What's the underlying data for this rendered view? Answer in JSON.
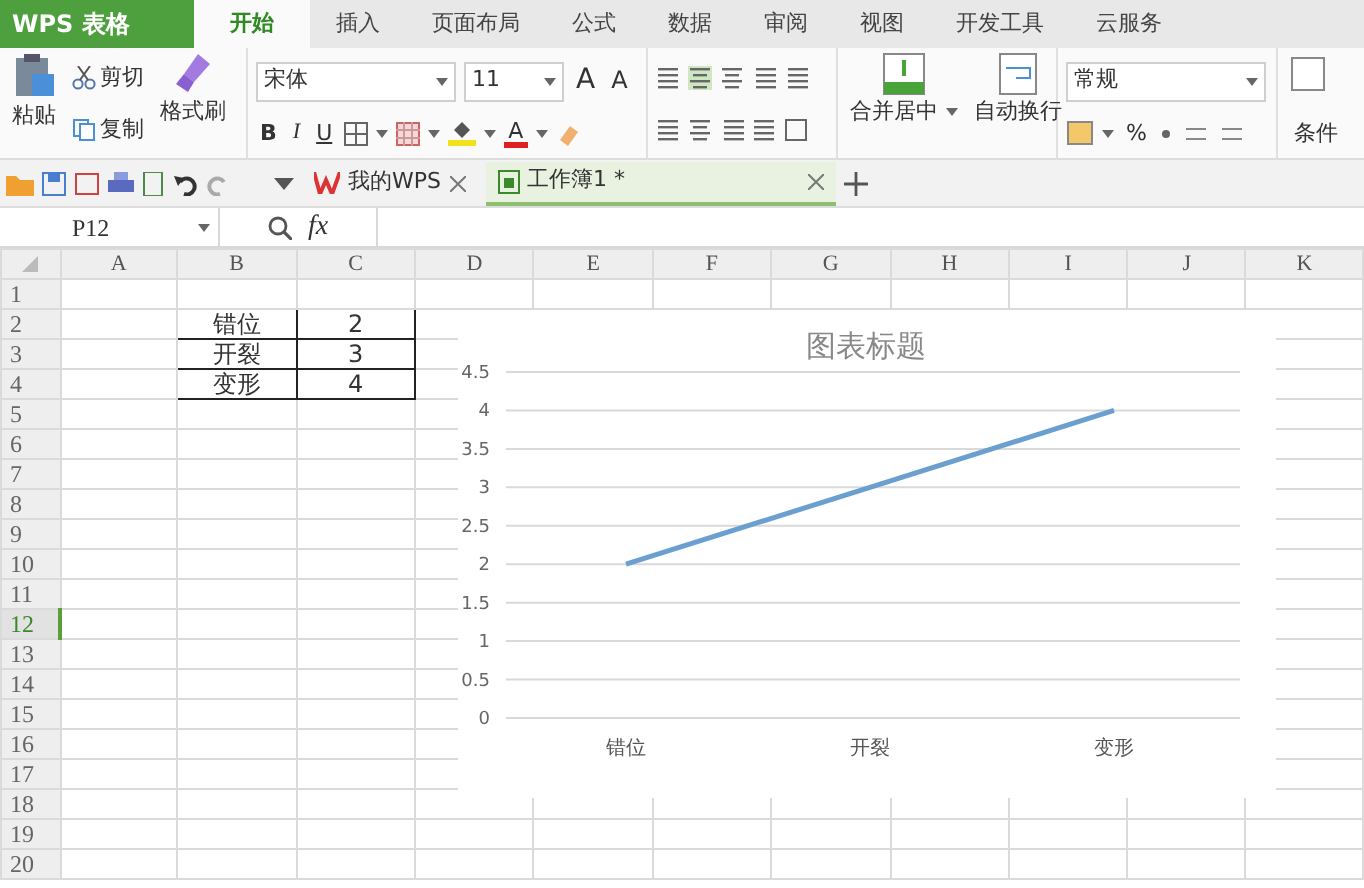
{
  "app": {
    "logo": "WPS 表格"
  },
  "menu_tabs": [
    {
      "label": "开始",
      "selected": true
    },
    {
      "label": "插入",
      "selected": false
    },
    {
      "label": "页面布局",
      "selected": false
    },
    {
      "label": "公式",
      "selected": false
    },
    {
      "label": "数据",
      "selected": false
    },
    {
      "label": "审阅",
      "selected": false
    },
    {
      "label": "视图",
      "selected": false
    },
    {
      "label": "开发工具",
      "selected": false
    },
    {
      "label": "云服务",
      "selected": false
    }
  ],
  "ribbon": {
    "clipboard": {
      "paste": "粘贴",
      "cut": "剪切",
      "copy": "复制",
      "format_painter": "格式刷"
    },
    "font": {
      "name": "宋体",
      "size": "11",
      "grow": "A",
      "shrink": "A",
      "bold": "B",
      "italic": "I",
      "underline": "U",
      "font_color": "A"
    },
    "alignment": {
      "merge": "合并居中",
      "wrap": "自动换行"
    },
    "number": {
      "format": "常规",
      "percent": "%"
    },
    "styles": {
      "conditional": "条件"
    }
  },
  "document_tabs": [
    {
      "label": "我的WPS",
      "selected": false
    },
    {
      "label": "工作簿1 *",
      "selected": true
    }
  ],
  "name_box": "P12",
  "formula_label": "fx",
  "sheet": {
    "columns": [
      "A",
      "B",
      "C",
      "D",
      "E",
      "F",
      "G",
      "H",
      "I",
      "J",
      "K"
    ],
    "rows": [
      {
        "label": "1",
        "selected": false
      },
      {
        "label": "2",
        "selected": false
      },
      {
        "label": "3",
        "selected": false
      },
      {
        "label": "4",
        "selected": false
      },
      {
        "label": "5",
        "selected": false
      },
      {
        "label": "6",
        "selected": false
      },
      {
        "label": "7",
        "selected": false
      },
      {
        "label": "8",
        "selected": false
      },
      {
        "label": "9",
        "selected": false
      },
      {
        "label": "10",
        "selected": false
      },
      {
        "label": "11",
        "selected": false
      },
      {
        "label": "12",
        "selected": true
      },
      {
        "label": "13",
        "selected": false
      },
      {
        "label": "14",
        "selected": false
      },
      {
        "label": "15",
        "selected": false
      },
      {
        "label": "16",
        "selected": false
      },
      {
        "label": "17",
        "selected": false
      },
      {
        "label": "18",
        "selected": false
      },
      {
        "label": "19",
        "selected": false
      },
      {
        "label": "20",
        "selected": false
      }
    ],
    "data": [
      [
        "错位",
        "2"
      ],
      [
        "开裂",
        "3"
      ],
      [
        "变形",
        "4"
      ]
    ],
    "chart_data": {
      "type": "line",
      "title": "图表标题",
      "categories": [
        "错位",
        "开裂",
        "变形"
      ],
      "series": [
        {
          "color": "#6a9fcf",
          "values": [
            2,
            3,
            4
          ]
        }
      ],
      "grid": true,
      "ylim": [
        0,
        4.5
      ],
      "yticks": [
        0,
        0.5,
        1,
        1.5,
        2,
        2.5,
        3,
        3.5,
        4,
        4.5
      ]
    }
  }
}
